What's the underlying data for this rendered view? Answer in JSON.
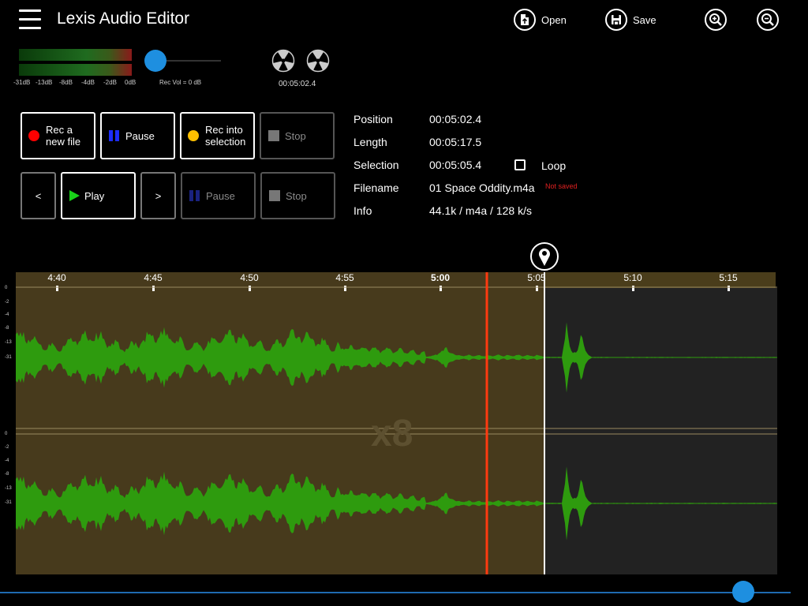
{
  "app": {
    "title": "Lexis Audio Editor"
  },
  "toolbar": {
    "open_label": "Open",
    "save_label": "Save",
    "zoom_in_icon": "zoom-in-icon",
    "zoom_out_icon": "zoom-out-icon"
  },
  "meters": {
    "scale": [
      "-31dB",
      "-13dB",
      "-8dB",
      "-4dB",
      "-2dB",
      "0dB"
    ],
    "rec_vol_label": "Rec Vol = 0 dB",
    "elapsed": "00:05:02.4"
  },
  "transport": {
    "rec_new": "Rec a\nnew file",
    "pause_rec": "Pause",
    "rec_selection": "Rec into\nselection",
    "stop_rec": "Stop",
    "prev": "<",
    "play": "Play",
    "next": ">",
    "pause_play": "Pause",
    "stop_play": "Stop"
  },
  "info": {
    "position_label": "Position",
    "position": "00:05:02.4",
    "length_label": "Length",
    "length": "00:05:17.5",
    "selection_label": "Selection",
    "selection": "00:05:05.4",
    "loop_label": "Loop",
    "filename_label": "Filename",
    "filename": "01 Space Oddity.m4a",
    "not_saved": "Not saved",
    "info_label": "Info",
    "info": "44.1k / m4a / 128 k/s"
  },
  "timeline": {
    "ticks": [
      "4:40",
      "4:45",
      "4:50",
      "4:55",
      "5:00",
      "5:05",
      "5:10",
      "5:15"
    ],
    "db_scale": [
      "0",
      "-2",
      "-4",
      "-8",
      "-13",
      "-31"
    ],
    "zoom": "x8"
  },
  "colors": {
    "wave": "#2e9b0e",
    "playhead": "#ff3a10",
    "selection_bg": "#473a1c",
    "accent": "#1e8fe0"
  }
}
